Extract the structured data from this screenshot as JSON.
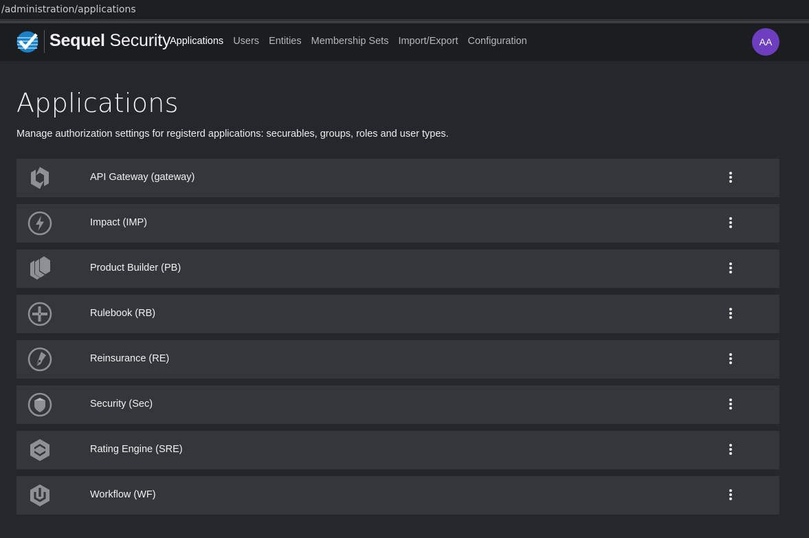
{
  "browser": {
    "url": "/administration/applications"
  },
  "brand": {
    "name_bold": "Sequel",
    "name_light": "Security"
  },
  "nav": {
    "items": [
      {
        "label": "Applications",
        "active": true
      },
      {
        "label": "Users",
        "active": false
      },
      {
        "label": "Entities",
        "active": false
      },
      {
        "label": "Membership Sets",
        "active": false
      },
      {
        "label": "Import/Export",
        "active": false
      },
      {
        "label": "Configuration",
        "active": false
      }
    ]
  },
  "user": {
    "initials": "AA",
    "avatar_color": "#6d3fc0"
  },
  "page": {
    "title": "Applications",
    "description": "Manage authorization settings for registerd applications: securables, groups, roles and user types."
  },
  "applications": [
    {
      "name": "API Gateway (gateway)",
      "icon": "gateway-icon"
    },
    {
      "name": "Impact (IMP)",
      "icon": "lightning-bolt-icon"
    },
    {
      "name": "Product Builder (PB)",
      "icon": "stacked-layers-icon"
    },
    {
      "name": "Rulebook (RB)",
      "icon": "plus-circle-icon"
    },
    {
      "name": "Reinsurance (RE)",
      "icon": "fountain-pen-icon"
    },
    {
      "name": "Security (Sec)",
      "icon": "shield-icon"
    },
    {
      "name": "Rating Engine (SRE)",
      "icon": "hexagon-chevron-icon"
    },
    {
      "name": "Workflow (WF)",
      "icon": "power-hexagon-icon"
    }
  ]
}
